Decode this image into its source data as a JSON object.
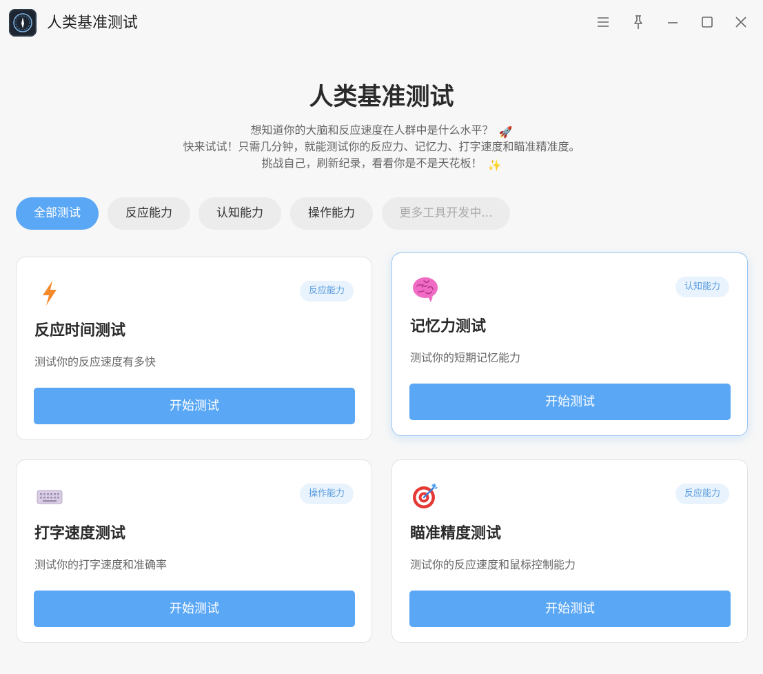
{
  "window": {
    "title": "人类基准测试",
    "controls": [
      "menu-icon",
      "pin-icon",
      "minimize-icon",
      "maximize-icon",
      "close-icon"
    ]
  },
  "hero": {
    "title": "人类基准测试",
    "line1": "想知道你的大脑和反应速度在人群中是什么水平？",
    "line1_emoji": "🚀",
    "line2": "快来试试！只需几分钟，就能测试你的反应力、记忆力、打字速度和瞄准精准度。",
    "line3": "挑战自己，刷新纪录，看看你是不是天花板！",
    "line3_emoji": "✨"
  },
  "tabs": [
    {
      "label": "全部测试"
    },
    {
      "label": "反应能力"
    },
    {
      "label": "认知能力"
    },
    {
      "label": "操作能力"
    },
    {
      "label": "更多工具开发中..."
    }
  ],
  "cards": [
    {
      "icon": "lightning-icon",
      "title": "反应时间测试",
      "desc": "测试你的反应速度有多快",
      "badge": "反应能力",
      "button": "开始测试"
    },
    {
      "icon": "brain-icon",
      "title": "记忆力测试",
      "desc": "测试你的短期记忆能力",
      "badge": "认知能力",
      "button": "开始测试"
    },
    {
      "icon": "keyboard-icon",
      "title": "打字速度测试",
      "desc": "测试你的打字速度和准确率",
      "badge": "操作能力",
      "button": "开始测试"
    },
    {
      "icon": "target-icon",
      "title": "瞄准精度测试",
      "desc": "测试你的反应速度和鼠标控制能力",
      "badge": "反应能力",
      "button": "开始测试"
    }
  ],
  "colors": {
    "accent": "#5aa7f5",
    "badge_bg": "#e9f3fd",
    "badge_text": "#5a9de0",
    "background": "#f7f7f7"
  }
}
